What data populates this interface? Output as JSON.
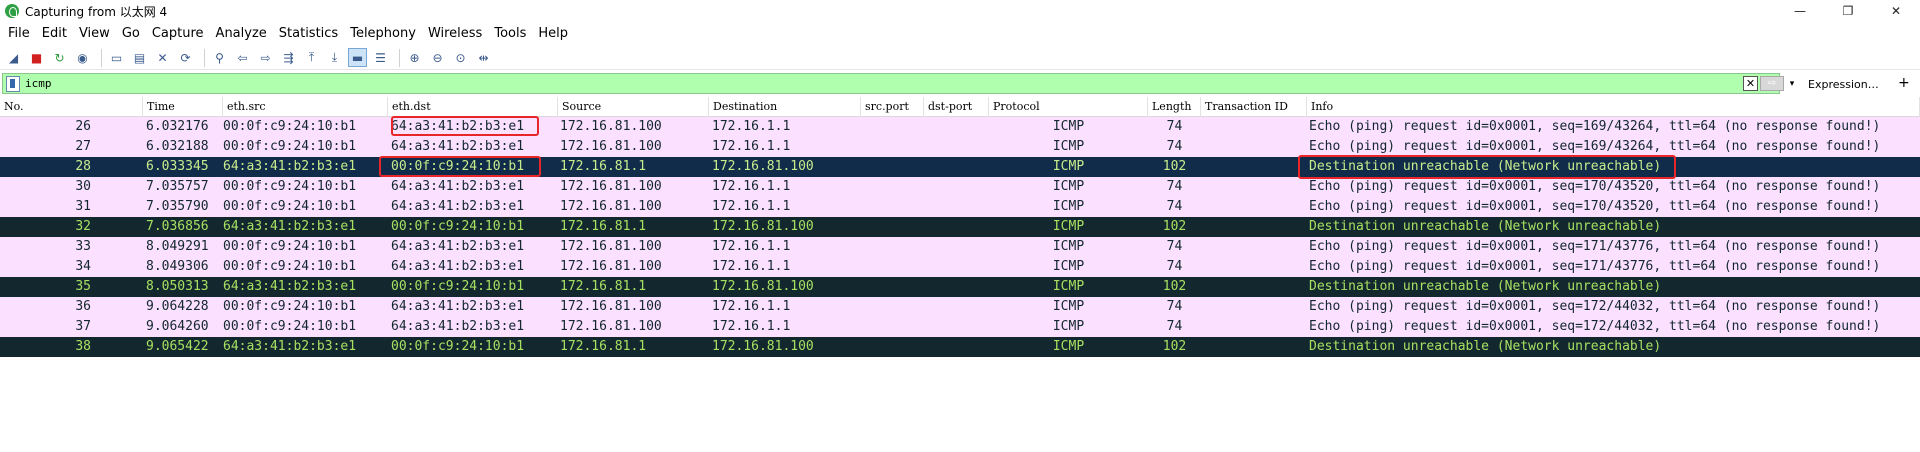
{
  "window": {
    "title": "Capturing from 以太网 4",
    "controls": [
      "—",
      "❐",
      "✕"
    ]
  },
  "menu": [
    {
      "label": "File",
      "accel": "F"
    },
    {
      "label": "Edit",
      "accel": "E"
    },
    {
      "label": "View",
      "accel": "V"
    },
    {
      "label": "Go",
      "accel": "G"
    },
    {
      "label": "Capture",
      "accel": "C"
    },
    {
      "label": "Analyze",
      "accel": "A"
    },
    {
      "label": "Statistics",
      "accel": "S"
    },
    {
      "label": "Telephony",
      "accel": "y"
    },
    {
      "label": "Wireless",
      "accel": "W"
    },
    {
      "label": "Tools",
      "accel": "T"
    },
    {
      "label": "Help",
      "accel": "H"
    }
  ],
  "toolbar_icons": [
    {
      "name": "start-capture-icon",
      "glyph": "◢"
    },
    {
      "name": "stop-capture-icon",
      "glyph": "■"
    },
    {
      "name": "restart-capture-icon",
      "glyph": "↻"
    },
    {
      "name": "capture-options-icon",
      "glyph": "◉"
    },
    {
      "name": "open-file-icon",
      "glyph": "▭"
    },
    {
      "name": "save-file-icon",
      "glyph": "▤"
    },
    {
      "name": "close-file-icon",
      "glyph": "✕"
    },
    {
      "name": "reload-file-icon",
      "glyph": "⟳"
    },
    {
      "name": "find-packet-icon",
      "glyph": "⚲"
    },
    {
      "name": "go-back-icon",
      "glyph": "⇦"
    },
    {
      "name": "go-forward-icon",
      "glyph": "⇨"
    },
    {
      "name": "go-to-packet-icon",
      "glyph": "⇶"
    },
    {
      "name": "first-packet-icon",
      "glyph": "⤒"
    },
    {
      "name": "last-packet-icon",
      "glyph": "⤓"
    },
    {
      "name": "autoscroll-icon",
      "glyph": "▬"
    },
    {
      "name": "colorize-icon",
      "glyph": "☰"
    },
    {
      "name": "zoom-in-icon",
      "glyph": "⊕"
    },
    {
      "name": "zoom-out-icon",
      "glyph": "⊖"
    },
    {
      "name": "zoom-normal-icon",
      "glyph": "⊙"
    },
    {
      "name": "resize-columns-icon",
      "glyph": "⇹"
    }
  ],
  "filter": {
    "value": "icmp",
    "clear_glyph": "✕",
    "apply_glyph": "⇨",
    "dropdown_glyph": "▾",
    "expression_label": "Expression…",
    "add_glyph": "+"
  },
  "columns": [
    "No.",
    "Time",
    "eth.src",
    "eth.dst",
    "Source",
    "Destination",
    "src.port",
    "dst-port",
    "Protocol",
    "Length",
    "Transaction ID",
    "Info"
  ],
  "packets": [
    {
      "no": "26",
      "time": "6.032176",
      "eth_src": "00:0f:c9:24:10:b1",
      "eth_dst": "64:a3:41:b2:b3:e1",
      "src": "172.16.81.100",
      "dst": "172.16.1.1",
      "proto": "ICMP",
      "len": "74",
      "info": "Echo (ping) request  id=0x0001, seq=169/43264, ttl=64 (no response found!)",
      "kind": "req"
    },
    {
      "no": "27",
      "time": "6.032188",
      "eth_src": "00:0f:c9:24:10:b1",
      "eth_dst": "64:a3:41:b2:b3:e1",
      "src": "172.16.81.100",
      "dst": "172.16.1.1",
      "proto": "ICMP",
      "len": "74",
      "info": "Echo (ping) request  id=0x0001, seq=169/43264, ttl=64 (no response found!)",
      "kind": "req"
    },
    {
      "no": "28",
      "time": "6.033345",
      "eth_src": "64:a3:41:b2:b3:e1",
      "eth_dst": "00:0f:c9:24:10:b1",
      "src": "172.16.81.1",
      "dst": "172.16.81.100",
      "proto": "ICMP",
      "len": "102",
      "info": "Destination unreachable (Network unreachable)",
      "kind": "sel"
    },
    {
      "no": "30",
      "time": "7.035757",
      "eth_src": "00:0f:c9:24:10:b1",
      "eth_dst": "64:a3:41:b2:b3:e1",
      "src": "172.16.81.100",
      "dst": "172.16.1.1",
      "proto": "ICMP",
      "len": "74",
      "info": "Echo (ping) request  id=0x0001, seq=170/43520, ttl=64 (no response found!)",
      "kind": "req"
    },
    {
      "no": "31",
      "time": "7.035790",
      "eth_src": "00:0f:c9:24:10:b1",
      "eth_dst": "64:a3:41:b2:b3:e1",
      "src": "172.16.81.100",
      "dst": "172.16.1.1",
      "proto": "ICMP",
      "len": "74",
      "info": "Echo (ping) request  id=0x0001, seq=170/43520, ttl=64 (no response found!)",
      "kind": "req"
    },
    {
      "no": "32",
      "time": "7.036856",
      "eth_src": "64:a3:41:b2:b3:e1",
      "eth_dst": "00:0f:c9:24:10:b1",
      "src": "172.16.81.1",
      "dst": "172.16.81.100",
      "proto": "ICMP",
      "len": "102",
      "info": "Destination unreachable (Network unreachable)",
      "kind": "unr"
    },
    {
      "no": "33",
      "time": "8.049291",
      "eth_src": "00:0f:c9:24:10:b1",
      "eth_dst": "64:a3:41:b2:b3:e1",
      "src": "172.16.81.100",
      "dst": "172.16.1.1",
      "proto": "ICMP",
      "len": "74",
      "info": "Echo (ping) request  id=0x0001, seq=171/43776, ttl=64 (no response found!)",
      "kind": "req"
    },
    {
      "no": "34",
      "time": "8.049306",
      "eth_src": "00:0f:c9:24:10:b1",
      "eth_dst": "64:a3:41:b2:b3:e1",
      "src": "172.16.81.100",
      "dst": "172.16.1.1",
      "proto": "ICMP",
      "len": "74",
      "info": "Echo (ping) request  id=0x0001, seq=171/43776, ttl=64 (no response found!)",
      "kind": "req"
    },
    {
      "no": "35",
      "time": "8.050313",
      "eth_src": "64:a3:41:b2:b3:e1",
      "eth_dst": "00:0f:c9:24:10:b1",
      "src": "172.16.81.1",
      "dst": "172.16.81.100",
      "proto": "ICMP",
      "len": "102",
      "info": "Destination unreachable (Network unreachable)",
      "kind": "unr"
    },
    {
      "no": "36",
      "time": "9.064228",
      "eth_src": "00:0f:c9:24:10:b1",
      "eth_dst": "64:a3:41:b2:b3:e1",
      "src": "172.16.81.100",
      "dst": "172.16.1.1",
      "proto": "ICMP",
      "len": "74",
      "info": "Echo (ping) request  id=0x0001, seq=172/44032, ttl=64 (no response found!)",
      "kind": "req"
    },
    {
      "no": "37",
      "time": "9.064260",
      "eth_src": "00:0f:c9:24:10:b1",
      "eth_dst": "64:a3:41:b2:b3:e1",
      "src": "172.16.81.100",
      "dst": "172.16.1.1",
      "proto": "ICMP",
      "len": "74",
      "info": "Echo (ping) request  id=0x0001, seq=172/44032, ttl=64 (no response found!)",
      "kind": "req"
    },
    {
      "no": "38",
      "time": "9.065422",
      "eth_src": "64:a3:41:b2:b3:e1",
      "eth_dst": "00:0f:c9:24:10:b1",
      "src": "172.16.81.1",
      "dst": "172.16.81.100",
      "proto": "ICMP",
      "len": "102",
      "info": "Destination unreachable (Network unreachable)",
      "kind": "unr"
    }
  ],
  "colors": {
    "request_row": "#fce0ff",
    "unreachable_row": "#12272e",
    "selected_row": "#102c4a",
    "filter_valid": "#afffaf",
    "annotation": "#e8262a"
  }
}
